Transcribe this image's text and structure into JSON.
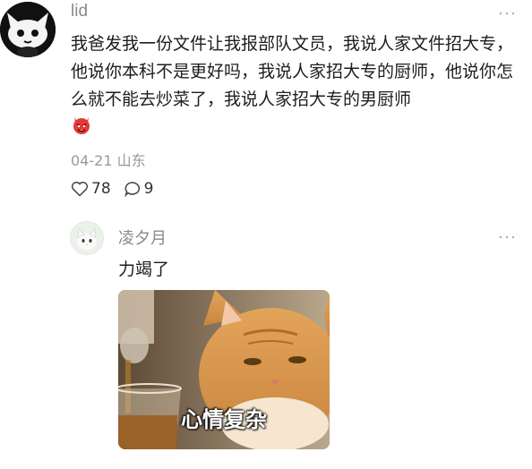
{
  "comment": {
    "username": "lid",
    "more_label": "···",
    "text": "我爸发我一份文件让我报部队文员，我说人家文件招大专，他说你本科不是更好吗，我说人家招大专的厨师，他说你怎么就不能去炒菜了，我说人家招大专的男厨师",
    "emoji": "devil-face",
    "date": "04-21",
    "location": "山东",
    "likes": "78",
    "replies_count": "9"
  },
  "reply": {
    "username": "凌夕月",
    "more_label": "···",
    "text": "力竭了",
    "image_caption": "心情复杂"
  },
  "colors": {
    "meta": "#999999",
    "text": "#1d1d1d",
    "username": "#8a8a8a"
  }
}
